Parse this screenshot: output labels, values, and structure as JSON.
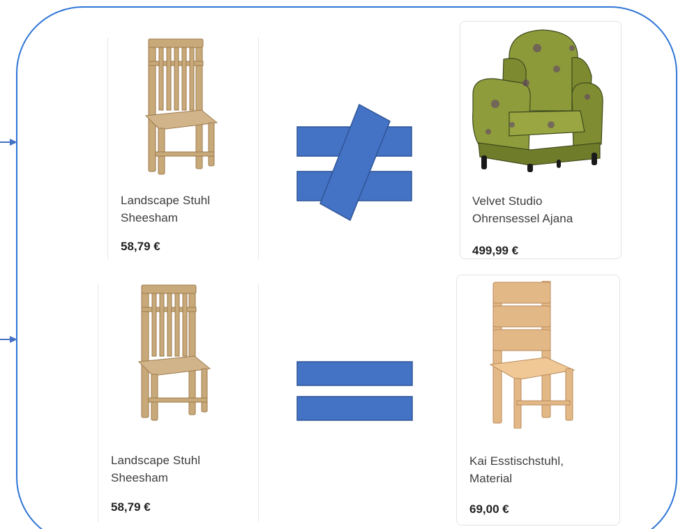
{
  "comparisons": [
    {
      "relation": "not-equal",
      "left_product": {
        "name": "Landscape Stuhl\nSheesham",
        "price": "58,79 €",
        "image": "wooden-slat-back-chair"
      },
      "right_product": {
        "name": "Velvet Studio\nOhrensessel Ajana",
        "price": "499,99 €",
        "image": "green-patterned-wingback-armchair"
      }
    },
    {
      "relation": "equal",
      "left_product": {
        "name": "Landscape Stuhl\nSheesham",
        "price": "58,79 €",
        "image": "wooden-slat-back-chair"
      },
      "right_product": {
        "name": "Kai Esstischstuhl,\nMaterial",
        "price": "69,00 €",
        "image": "light-beech-dining-chair"
      }
    }
  ],
  "colors": {
    "frame": "#2e75d6",
    "symbol_fill": "#4472c4",
    "symbol_stroke": "#2f5597",
    "arrow": "#4472c4"
  }
}
